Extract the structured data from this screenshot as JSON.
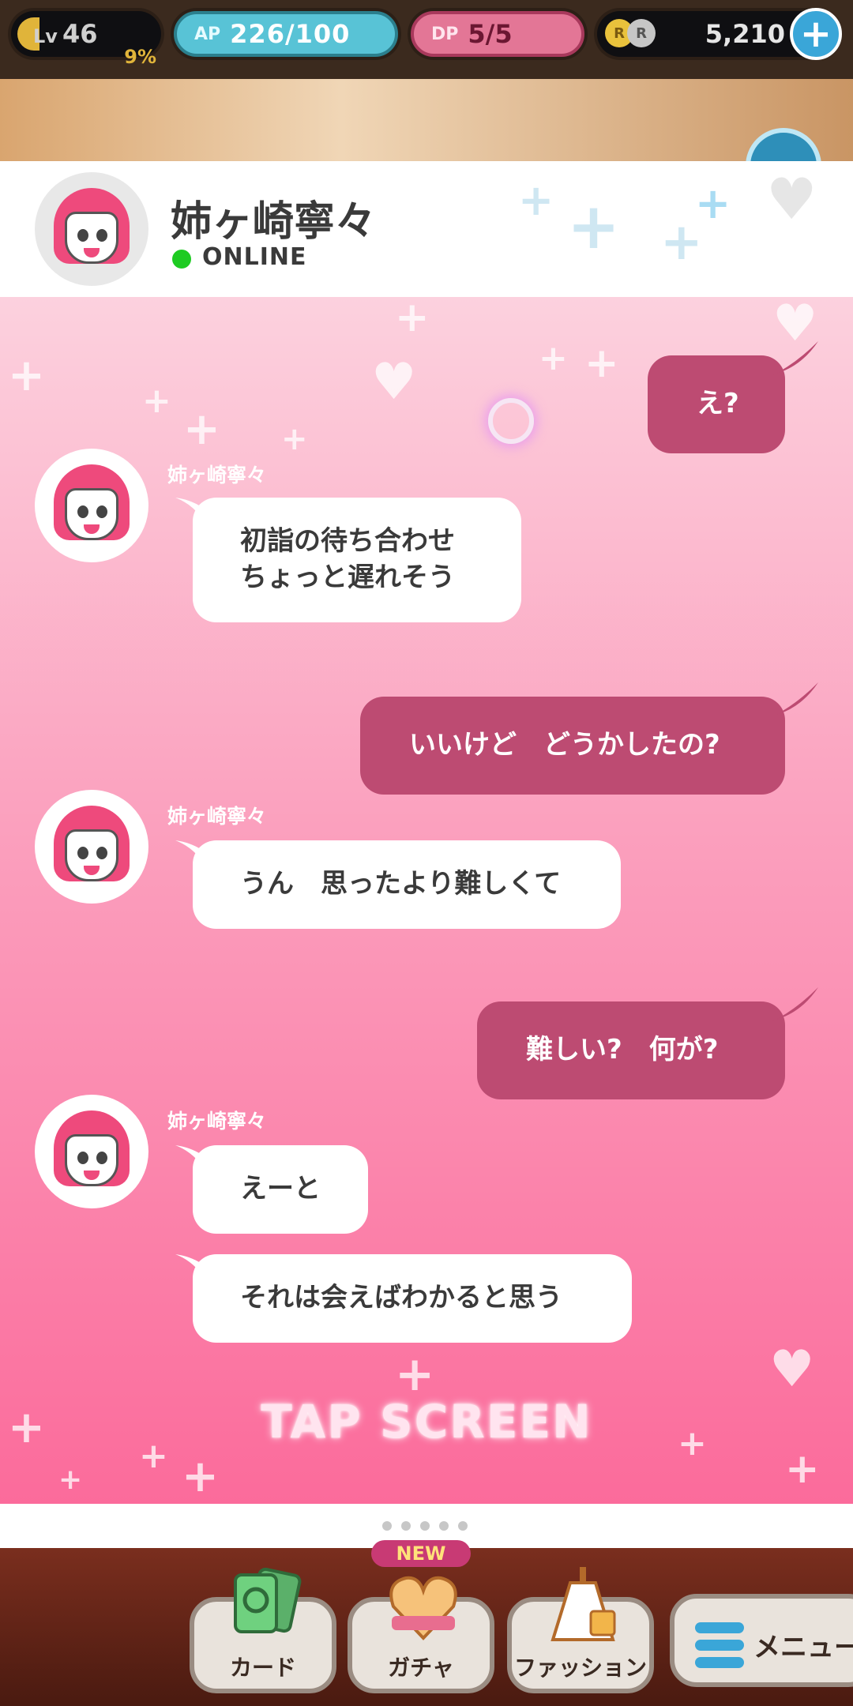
{
  "status_bar": {
    "level_label": "Lv",
    "level_value": "46",
    "level_progress": "9%",
    "ap_label": "AP",
    "ap_value": "226/100",
    "dp_label": "DP",
    "dp_value": "5/5",
    "coin_icon_1": "R",
    "coin_icon_2": "R",
    "coins": "5,210",
    "add_icon": "plus-icon"
  },
  "header": {
    "contact_name": "姉ヶ崎寧々",
    "status_text": "ONLINE",
    "status_color": "#1ecb22"
  },
  "chat": {
    "messages": [
      {
        "from": "me",
        "text": "え?"
      },
      {
        "from": "other",
        "sender": "姉ヶ崎寧々",
        "line1": "初詣の待ち合わせ",
        "line2": "ちょっと遅れそう"
      },
      {
        "from": "me",
        "text": "いいけど　どうかしたの?"
      },
      {
        "from": "other",
        "sender": "姉ヶ崎寧々",
        "text": "うん　思ったより難しくて"
      },
      {
        "from": "me",
        "text": "難しい?　何が?"
      },
      {
        "from": "other",
        "sender": "姉ヶ崎寧々",
        "text": "えーと"
      },
      {
        "from": "other",
        "text": "それは会えばわかると思う"
      }
    ],
    "tap_prompt": "TAP SCREEN"
  },
  "pager": {
    "count": 5
  },
  "bottom_nav": {
    "card_label": "カード",
    "gacha_label": "ガチャ",
    "gacha_badge": "NEW",
    "fashion_label": "ファッション",
    "menu_label": "メニュー"
  },
  "colors": {
    "bubble_out": "#bd4b72",
    "bubble_in": "#ffffff",
    "chat_bg_top": "#fcd1de",
    "chat_bg_bottom": "#fb6b9b"
  }
}
